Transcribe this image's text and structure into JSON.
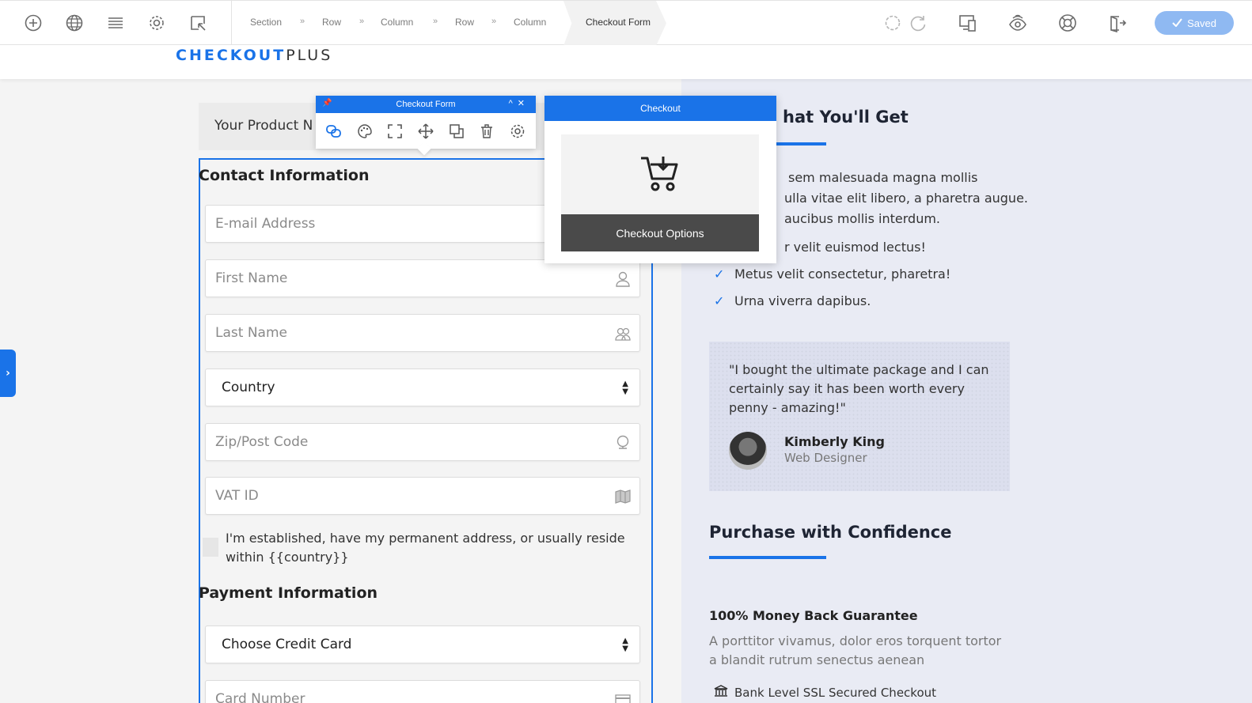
{
  "toolbar": {
    "icons": [
      "add-icon",
      "globe-icon",
      "layers-icon",
      "gear-icon",
      "select-icon"
    ],
    "breadcrumbs": [
      "Section",
      "Row",
      "Column",
      "Row",
      "Column"
    ],
    "breadcrumb_separator": "»",
    "active_crumb": "Checkout Form",
    "saved_label": "Saved",
    "right_icons": [
      "undo-icon",
      "redo-icon",
      "responsive-icon",
      "preview-icon",
      "help-icon",
      "exit-icon"
    ],
    "accent": "#1a73e8"
  },
  "site": {
    "logo_a": "CHECKOUT",
    "logo_b": "PLUS"
  },
  "product_bar": {
    "label": "Your Product N"
  },
  "form": {
    "contact_heading": "Contact Information",
    "fields": [
      {
        "placeholder": "E-mail Address",
        "icon": "envelope-icon"
      },
      {
        "placeholder": "First Name",
        "icon": "user-icon"
      },
      {
        "placeholder": "Last Name",
        "icon": "users-icon"
      },
      {
        "value": "Country",
        "icon": "select-arrows"
      },
      {
        "placeholder": "Zip/Post Code",
        "icon": "globe-icon"
      },
      {
        "placeholder": "VAT ID",
        "icon": "map-icon"
      }
    ],
    "residence_checkbox_label": "I'm established, have my permanent address, or usually reside within {{country}}",
    "payment_heading": "Payment Information",
    "card_select": "Choose Credit Card",
    "card_number_placeholder": "Card Number"
  },
  "element_toolbar": {
    "title": "Checkout Form",
    "tools": [
      "link-icon",
      "palette-icon",
      "expand-icon",
      "move-icon",
      "duplicate-icon",
      "trash-icon",
      "gear-icon"
    ]
  },
  "checkout_popup": {
    "title": "Checkout",
    "button": "Checkout Options"
  },
  "right": {
    "heading_1": "hat You'll Get",
    "para_lines": [
      "sem malesuada magna mollis",
      "ulla vitae elit libero, a pharetra augue.",
      "aucibus mollis interdum."
    ],
    "bullet_partial": "r velit euismod lectus!",
    "bullets": [
      "Metus velit consectetur, pharetra!",
      "Urna viverra dapibus."
    ],
    "quote": "\"I bought the ultimate package and I can certainly say it has been worth every penny - amazing!\"",
    "quote_name": "Kimberly King",
    "quote_role": "Web Designer",
    "heading_2": "Purchase with Confidence",
    "guarantee_title": "100% Money Back Guarantee",
    "guarantee_text": "A porttitor vivamus, dolor eros torquent tortor a blandit rutrum senectus aenean",
    "ssl_label": "Bank Level SSL Secured Checkout"
  }
}
